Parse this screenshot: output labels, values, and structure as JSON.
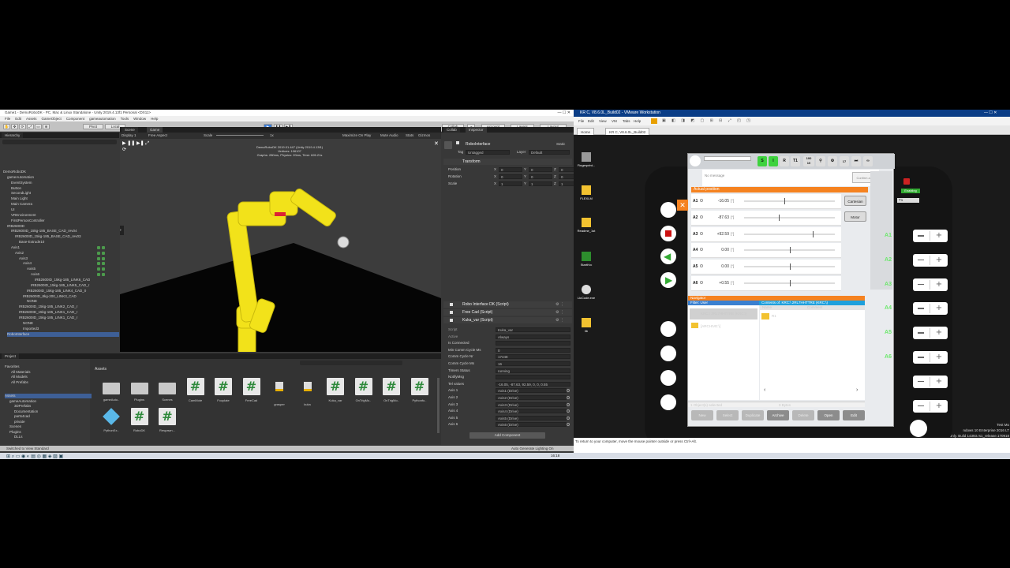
{
  "unity": {
    "title": "Game1 - DemoRoboDK - PC, Mac & Linux Standalone - Unity 2019.4.13f1 Personal <DX11>",
    "menu": [
      "File",
      "Edit",
      "Assets",
      "GameObject",
      "Component",
      "gameautomation",
      "Tools",
      "Window",
      "Help"
    ],
    "toolbar": {
      "pivot": "Pivot",
      "local": "Local",
      "collab": "Collab",
      "account": "Account",
      "layers": "Layers",
      "layout": "Layout"
    },
    "hierarchy": {
      "tab": "Hierarchy",
      "items": [
        "DemoRoboDK",
        "gameAutomation",
        "EventSystem",
        "Button",
        "SecondLight",
        "Main Light",
        "Main Camera",
        "UI",
        "VREnvironment",
        "FirstPersonController",
        "IRB2600ID",
        "IRB2600ID_15kg-185_BASE_CAD_rev04",
        "IRB2600ID_15kg-185_BASE_CAD_rev03",
        "Base-Extrude10",
        "Axis1",
        "Axis2",
        "Axis3",
        "Axis4",
        "Axis5",
        "Axis6",
        "IRB2600ID_15kg-185_LINK6_CAD",
        "IRB2600ID_15kg-185_LINK5_CAD_r",
        "IRB2600ID_15kg-185_LINK4_CAD_0",
        "IRB2600ID_8kg-200_LINK3_CAD",
        "NONE",
        "IRB2600ID_15kg-185_LINK2_CAD_r",
        "IRB2600ID_15kg-185_LINK1_CAD_r",
        "IRB2600ID_15kg-185_LINK1_CAD_r",
        "NONE",
        "Imported3",
        "RoboInterface"
      ]
    },
    "scene": {
      "tabs": [
        "Scene",
        "Game"
      ],
      "display": "Display 1",
      "aspect": "Free Aspect",
      "scale_label": "Scale",
      "scale_value": "1x",
      "maximize": "Maximize On Play",
      "mute": "Mute Audio",
      "stats": "Stats",
      "gizmos": "Gizmos",
      "overlay": [
        "DemoRoboDK 2019.01.447 (Unity 2019.4.13f1)",
        "Vertices: 106107",
        "Graphs: 280ms, Physics: 20ms, Time: 626.21s"
      ]
    },
    "inspector": {
      "tabs": [
        "Collab",
        "Inspector"
      ],
      "object": "RoboInterface",
      "static": "Static",
      "tag_label": "Tag",
      "tag": "Untagged",
      "layer_label": "Layer",
      "layer": "Default",
      "transform": "Transform",
      "rows": [
        {
          "label": "Position",
          "x": "0",
          "y": "0",
          "z": "0"
        },
        {
          "label": "Rotation",
          "x": "0",
          "y": "0",
          "z": "0"
        },
        {
          "label": "Scale",
          "x": "1",
          "y": "1",
          "z": "1"
        }
      ],
      "components": [
        "Robo Interface DK (Script)",
        "Free Cad (Script)",
        "Kuka_var (Script)"
      ],
      "fields": [
        [
          "Script",
          "Kuka_var"
        ],
        [
          "Active",
          "Always"
        ],
        [
          "Is Connected",
          ""
        ],
        [
          "Min Comm Cycle Ms",
          "0"
        ],
        [
          "Comm Cycle Nr",
          "17448"
        ],
        [
          "Comm Cycle Ms",
          "16"
        ],
        [
          "Timers Status",
          "running"
        ],
        [
          "NotifyMsg",
          ""
        ],
        [
          "Tel values",
          "-16.05, -87.63, 92.59, 0, 0, 0.55"
        ],
        [
          "Axis 1",
          "Axis1 (Drive)"
        ],
        [
          "Axis 2",
          "Axis2 (Drive)"
        ],
        [
          "Axis 3",
          "Axis3 (Drive)"
        ],
        [
          "Axis 4",
          "Axis4 (Drive)"
        ],
        [
          "Axis 5",
          "Axis5 (Drive)"
        ],
        [
          "Axis 6",
          "Axis6 (Drive)"
        ]
      ],
      "add_component": "Add Component"
    },
    "project": {
      "tab": "Project",
      "favorites": [
        "Favorites",
        "All Materials",
        "All Models",
        "All Prefabs"
      ],
      "assets_tree": [
        "Assets",
        "gameAutomation",
        "3DPrefabs",
        "Documentation",
        "parts4cad",
        "private",
        "Scenes",
        "Plugins",
        "DLLs"
      ],
      "breadcrumb": "Assets",
      "assets": [
        "gameAuto..",
        "Plugins",
        "Scenes",
        "CamMote",
        "Fooplate",
        "FreeCad",
        "grasper",
        "kuka",
        "Kuka_var",
        "OnTrigMo..",
        "OnTrigMo..",
        "Pythonfo..",
        "PythonEx..",
        "RoboDK",
        "Respawn..."
      ]
    },
    "status": "Switched to View Standard",
    "status_right": "Auto Generate Lighting On",
    "time": "16:18"
  },
  "vmware": {
    "title": "KR C, V8.6.0L_Build02 - VMware Workstation",
    "menu": [
      "File",
      "Edit",
      "View",
      "VM",
      "Tabs",
      "Help"
    ],
    "tabs": [
      "Home",
      "KR C, V8.6.0L_Build02"
    ],
    "desktop": [
      "Fingerprint...",
      "FLEXLM",
      "Readme_1st",
      "StartKrc",
      "LicCode.exe",
      "lib"
    ],
    "footer": "To return to your computer, move the mouse pointer outside or press Ctrl+Alt.",
    "win": [
      "Test Mo",
      "ndows 10 Enterprise 2016 LT",
      "Evaluation purpose only. Build 14393.rs1_release.170918"
    ]
  },
  "kuka": {
    "speed": "100",
    "step": "10",
    "mode": "T1",
    "ov": "17",
    "status_buttons": [
      "S",
      "I",
      "R",
      "T1"
    ],
    "message": "No message",
    "confirm": "Confirm all",
    "section": "Actual position",
    "cartesian": "Cartesian",
    "motor": "Motor",
    "axes": [
      {
        "name": "A1",
        "value": "-16.05",
        "unit": "[°]",
        "pos": 0.44
      },
      {
        "name": "A2",
        "value": "-87.63",
        "unit": "[°]",
        "pos": 0.38
      },
      {
        "name": "A3",
        "value": "+92.59",
        "unit": "[°]",
        "pos": 0.76
      },
      {
        "name": "A4",
        "value": "0.00",
        "unit": "[°]",
        "pos": 0.5
      },
      {
        "name": "A5",
        "value": "0.00",
        "unit": "[°]",
        "pos": 0.5
      },
      {
        "name": "A6",
        "value": "+0.55",
        "unit": "[°]",
        "pos": 0.5
      }
    ],
    "navigator": "Navigator",
    "filter": "Filter: User",
    "tree": [
      "KRC:\\ 2RL7HHTTRE (KRC:\\)",
      "[ARCHIVE:\\]"
    ],
    "contents": "Contents of: KRC:\\ 2RL7HHTTRE (KRC:\\)",
    "cols": [
      "Name",
      "Comment"
    ],
    "rows": [
      "R1"
    ],
    "selected": "1 Object(s) selected",
    "bytes": "0 Bytes",
    "bottom": [
      "New",
      "Select",
      "Duplicate",
      "Archive",
      "Delete",
      "Open",
      "Edit"
    ],
    "enabling": "Enabling",
    "right_mode": "T1",
    "jog_labels": [
      "A1",
      "A2",
      "A3",
      "A4",
      "A5",
      "A6"
    ]
  }
}
